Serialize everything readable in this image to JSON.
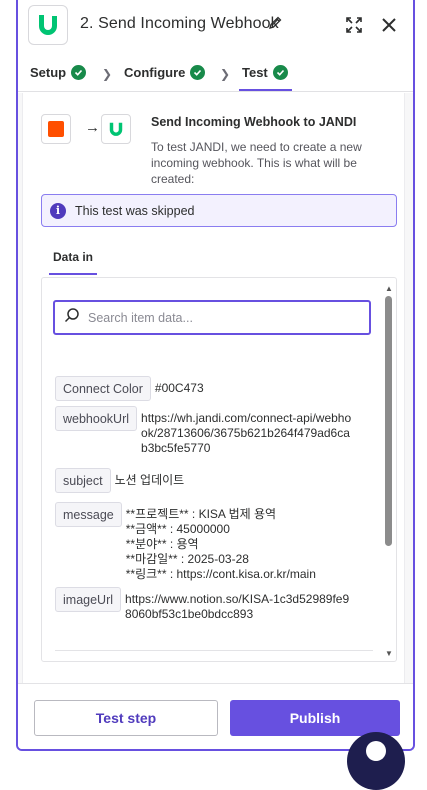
{
  "header": {
    "step_title": "2. Send Incoming Webhook",
    "icons": [
      "jandi-logo-icon",
      "pencil-icon",
      "expand-icon",
      "close-icon"
    ]
  },
  "tabs": [
    {
      "label": "Setup",
      "status": "complete"
    },
    {
      "label": "Configure",
      "status": "complete"
    },
    {
      "label": "Test",
      "status": "complete",
      "active": true
    }
  ],
  "connection": {
    "title": "Send Incoming Webhook to JANDI",
    "description": "To test JANDI, we need to create a new incoming webhook. This is what will be created:"
  },
  "info_banner": {
    "text": "This test was skipped"
  },
  "data_in": {
    "tab_label": "Data in",
    "search_placeholder": "Search item data...",
    "fields": [
      {
        "key": "Connect Color",
        "value": "#00C473"
      },
      {
        "key": "webhookUrl",
        "value": "https://wh.jandi.com/connect-api/webhook/28713606/3675b621b264f479ad6cab3bc5fe5770"
      },
      {
        "key": "subject",
        "value": "노션 업데이트"
      },
      {
        "key": "message",
        "value": "**프로젝트** : KISA 법제 용역\n**금액** : 45000000\n**분야** :  용역\n**마감일** : 2025-03-28\n**링크** : https://cont.kisa.or.kr/main"
      },
      {
        "key": "imageUrl",
        "value": "https://www.notion.so/KISA-1c3d52989fe98060bf53c1be0bdcc893"
      }
    ]
  },
  "footer": {
    "test_step_label": "Test step",
    "publish_label": "Publish"
  },
  "colors": {
    "accent": "#6750e0",
    "success": "#188a4a",
    "jandi_green": "#00c473",
    "trigger_orange": "#ff4f00"
  }
}
